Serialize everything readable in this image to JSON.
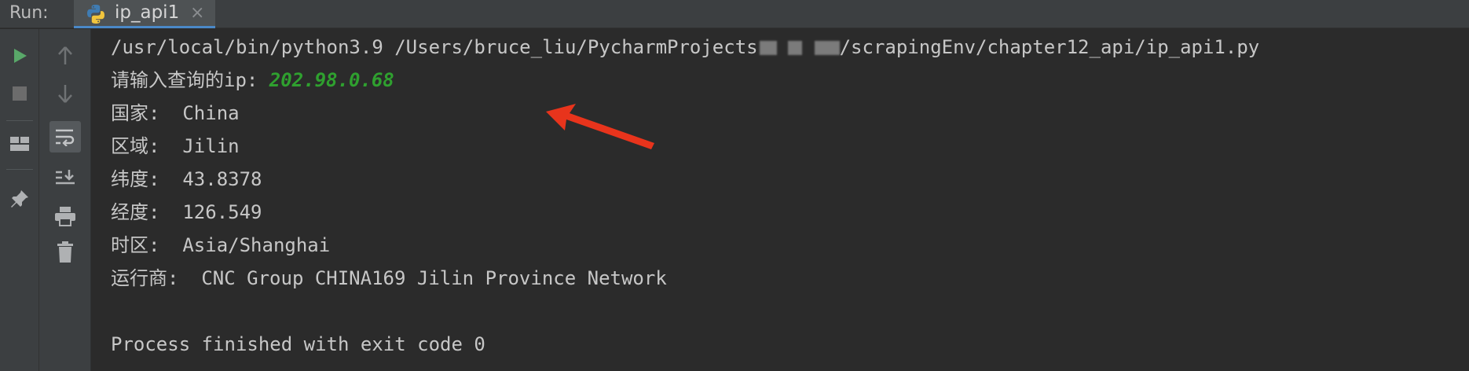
{
  "run_panel": {
    "label": "Run:",
    "tab": {
      "title": "ip_api1",
      "close_glyph": "×",
      "icon": "python-icon"
    }
  },
  "toolbar_left": [
    {
      "name": "run-icon",
      "color": "#59a869"
    },
    {
      "name": "stop-icon",
      "color": "#6c6c6c"
    },
    {
      "name": "layout-icon",
      "color": "#afb1b3"
    },
    {
      "name": "pin-icon",
      "color": "#afb1b3"
    }
  ],
  "toolbar_mid": [
    {
      "name": "up-arrow-icon"
    },
    {
      "name": "down-arrow-icon"
    },
    {
      "name": "soft-wrap-icon",
      "active": true
    },
    {
      "name": "scroll-to-end-icon"
    },
    {
      "name": "print-icon"
    },
    {
      "name": "trash-icon"
    }
  ],
  "console": {
    "command_prefix": "/usr/local/bin/python3.9 /Users/bruce_liu/PycharmProjects",
    "command_suffix": "/scrapingEnv/chapter12_api/ip_api1.py",
    "prompt": "请输入查询的ip: ",
    "input_value": "202.98.0.68",
    "results": [
      "国家:  China",
      "区域:  Jilin",
      "纬度:  43.8378",
      "经度:  126.549",
      "时区:  Asia/Shanghai",
      "运行商:  CNC Group CHINA169 Jilin Province Network"
    ],
    "exit_message": "Process finished with exit code 0"
  },
  "colors": {
    "background": "#2b2b2b",
    "text": "#c7c7c7",
    "input": "#2fa02f",
    "annotation_arrow": "#e8341c"
  }
}
